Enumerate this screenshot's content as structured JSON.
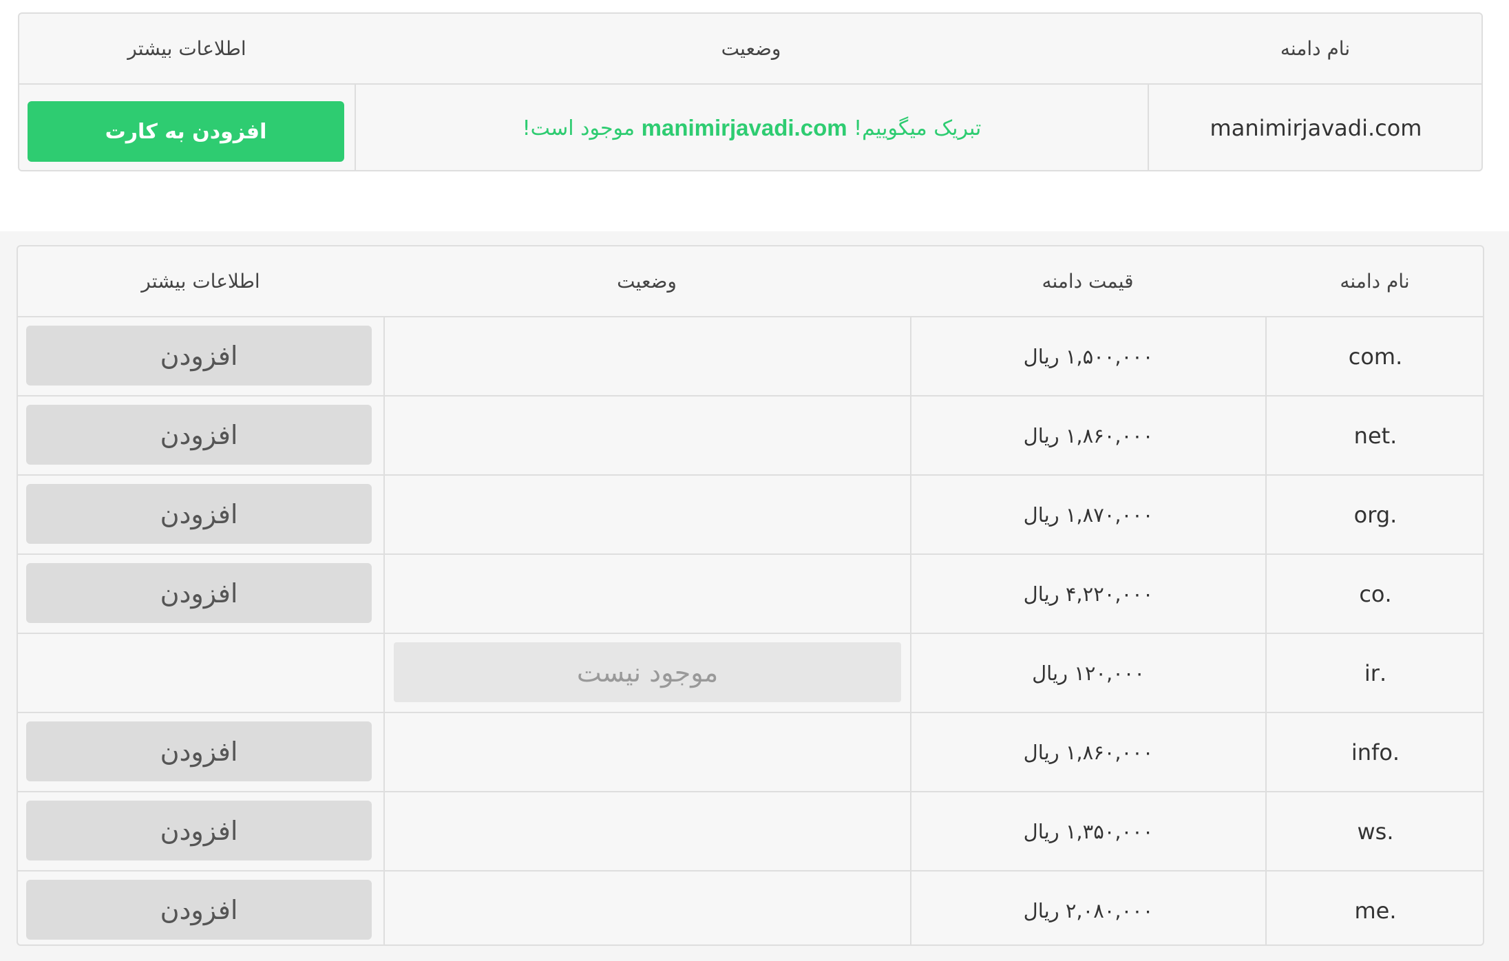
{
  "top_result": {
    "headers": {
      "domain": "نام دامنه",
      "status": "وضعیت",
      "more": "اطلاعات بیشتر"
    },
    "domain": "manimirjavadi.com",
    "status_prefix": "تبریک میگوییم!",
    "status_domain": "manimirjavadi.com",
    "status_suffix": "موجود است!",
    "add_to_cart": "افزودن به کارت"
  },
  "suggestions": {
    "headers": {
      "domain": "نام دامنه",
      "price": "قیمت دامنه",
      "status": "وضعیت",
      "more": "اطلاعات بیشتر"
    },
    "rows": [
      {
        "tld": ".com",
        "price": "۱,۵۰۰,۰۰۰ ریال",
        "status": "",
        "action": "افزودن"
      },
      {
        "tld": ".net",
        "price": "۱,۸۶۰,۰۰۰ ریال",
        "status": "",
        "action": "افزودن"
      },
      {
        "tld": ".org",
        "price": "۱,۸۷۰,۰۰۰ ریال",
        "status": "",
        "action": "افزودن"
      },
      {
        "tld": ".co",
        "price": "۴,۲۲۰,۰۰۰ ریال",
        "status": "",
        "action": "افزودن"
      },
      {
        "tld": ".ir",
        "price": "۱۲۰,۰۰۰ ریال",
        "status": "موجود نیست",
        "action": ""
      },
      {
        "tld": ".info",
        "price": "۱,۸۶۰,۰۰۰ ریال",
        "status": "",
        "action": "افزودن"
      },
      {
        "tld": ".ws",
        "price": "۱,۳۵۰,۰۰۰ ریال",
        "status": "",
        "action": "افزودن"
      },
      {
        "tld": ".me",
        "price": "۲,۰۸۰,۰۰۰ ریال",
        "status": "",
        "action": "افزودن"
      }
    ]
  },
  "colors": {
    "accent": "#2ecc71",
    "border": "#dedede",
    "button_gray": "#dcdcdc"
  }
}
